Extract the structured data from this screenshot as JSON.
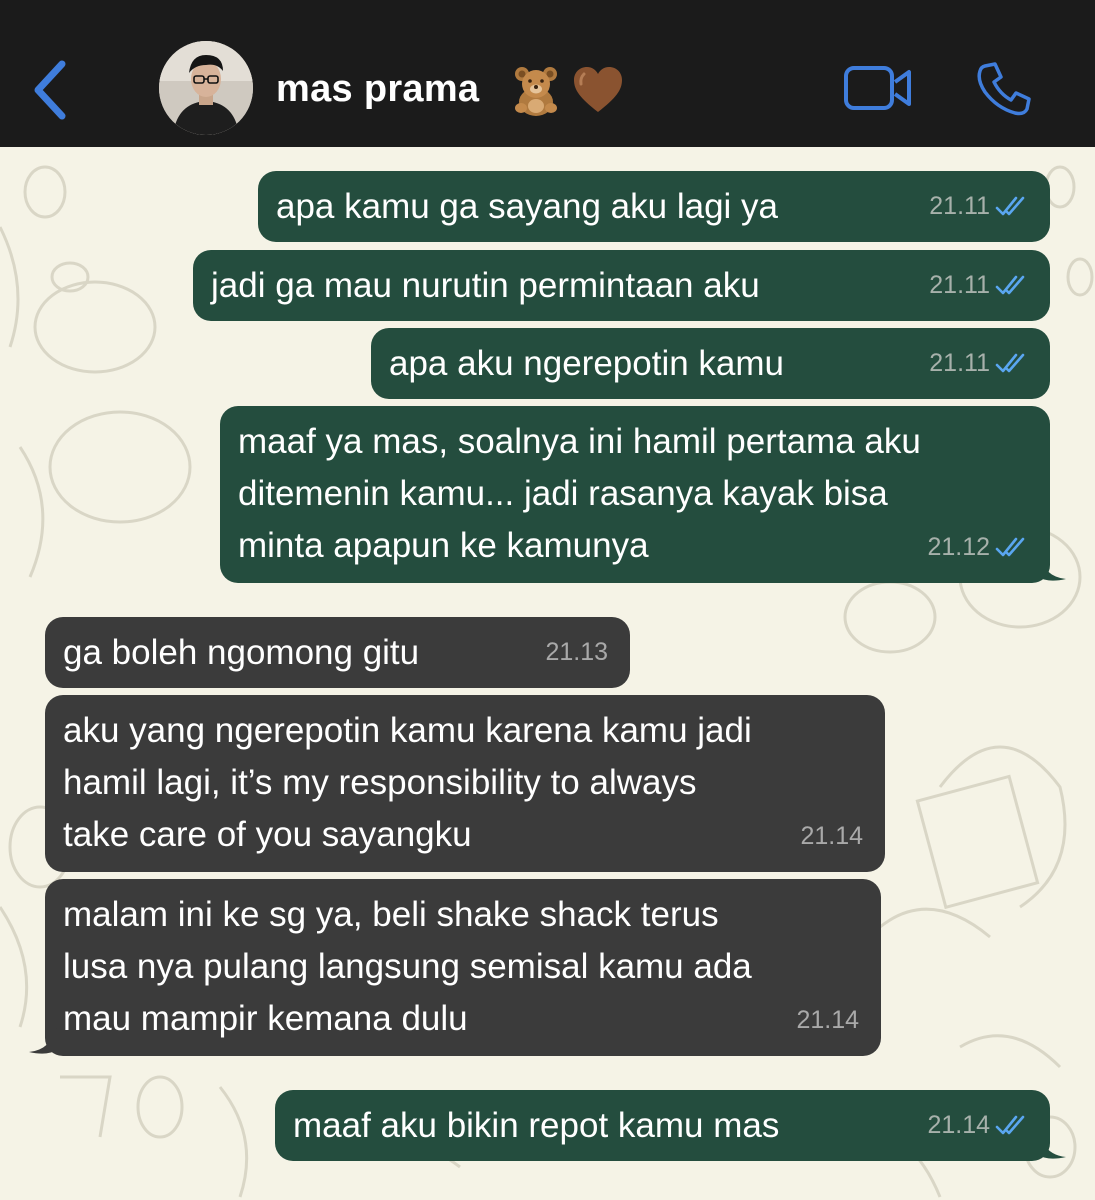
{
  "header": {
    "contact_name": "mas prama",
    "emoji_1": "teddy-bear",
    "emoji_2": "brown-heart"
  },
  "colors": {
    "header_bg": "#1b1b1b",
    "accent": "#3f7ddc",
    "outgoing_bubble": "#244d3e",
    "incoming_bubble": "#3b3b3b",
    "wallpaper": "#f5f3e6",
    "read_ticks": "#5aa6f0"
  },
  "messages": [
    {
      "direction": "out",
      "lines": [
        "apa kamu ga sayang aku lagi ya"
      ],
      "time": "21.11",
      "read": true
    },
    {
      "direction": "out",
      "lines": [
        "jadi ga mau nurutin permintaan aku"
      ],
      "time": "21.11",
      "read": true
    },
    {
      "direction": "out",
      "lines": [
        "apa aku ngerepotin kamu"
      ],
      "time": "21.11",
      "read": true
    },
    {
      "direction": "out",
      "lines": [
        "maaf ya mas, soalnya ini hamil pertama aku",
        "ditemenin kamu... jadi rasanya kayak bisa",
        "minta apapun ke kamunya"
      ],
      "time": "21.12",
      "read": true
    },
    {
      "direction": "in",
      "lines": [
        "ga boleh ngomong gitu"
      ],
      "time": "21.13"
    },
    {
      "direction": "in",
      "lines": [
        "aku yang ngerepotin kamu karena kamu jadi",
        "hamil lagi, it’s my responsibility to always",
        "take care of you sayangku"
      ],
      "time": "21.14"
    },
    {
      "direction": "in",
      "lines": [
        "malam ini ke sg ya, beli shake shack terus",
        "lusa nya pulang langsung semisal kamu ada",
        "mau mampir kemana dulu"
      ],
      "time": "21.14"
    },
    {
      "direction": "out",
      "lines": [
        "maaf aku bikin repot kamu mas"
      ],
      "time": "21.14",
      "read": true
    }
  ]
}
